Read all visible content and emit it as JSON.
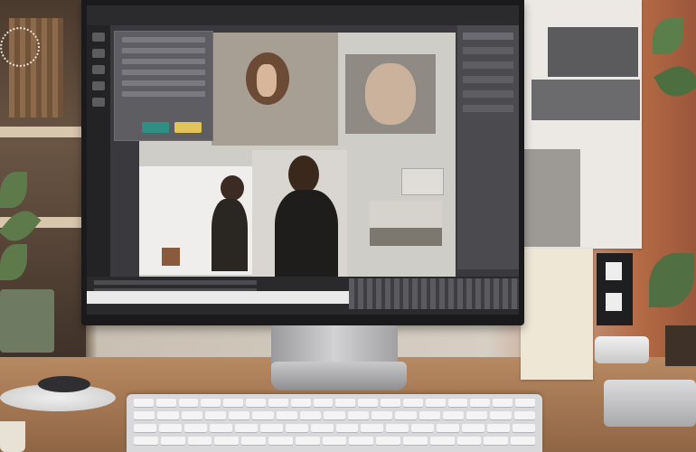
{
  "scene": {
    "type": "photo",
    "subject": "desktop-workspace"
  },
  "app": {
    "menu": [
      "",
      "",
      "",
      ""
    ],
    "panel_button": ""
  },
  "colors": {
    "wall": "#d7cfc4",
    "desk": "#a77a55",
    "monitor_bezel": "#1a1a1c",
    "app_background": "#3a3a3e",
    "accent_wall": "#b36a45"
  }
}
